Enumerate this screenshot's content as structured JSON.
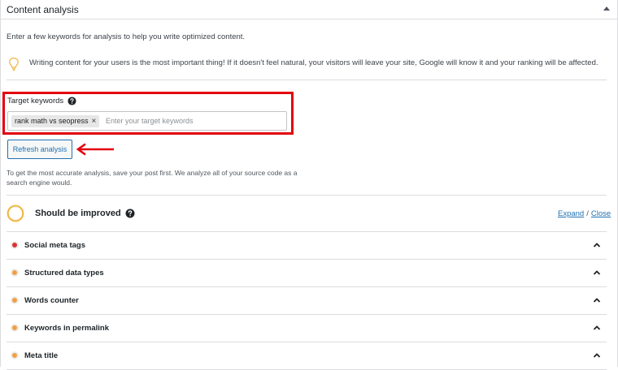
{
  "panel": {
    "title": "Content analysis",
    "intro": "Enter a few keywords for analysis to help you write optimized content.",
    "tip": "Writing content for your users is the most important thing! If it doesn't feel natural, your visitors will leave your site, Google will know it and your ranking will be affected."
  },
  "keywords": {
    "label": "Target keywords",
    "tag": "rank math vs seopress",
    "tag_remove": "×",
    "placeholder": "Enter your target keywords"
  },
  "refresh_label": "Refresh analysis",
  "help_text": "To get the most accurate analysis, save your post first. We analyze all of your source code as a search engine would.",
  "score": {
    "title": "Should be improved",
    "expand_label": "Expand",
    "separator": "/",
    "close_label": "Close",
    "ring_color": "#f0b849"
  },
  "checks": [
    {
      "label": "Social meta tags",
      "status": "error",
      "color": "#dc3232"
    },
    {
      "label": "Structured data types",
      "status": "warning",
      "color": "#f0a042"
    },
    {
      "label": "Words counter",
      "status": "warning",
      "color": "#f0a042"
    },
    {
      "label": "Keywords in permalink",
      "status": "warning",
      "color": "#f0a042"
    },
    {
      "label": "Meta title",
      "status": "warning",
      "color": "#f0a042"
    }
  ],
  "colors": {
    "accent": "#2271b1",
    "annotation": "#e3000f",
    "divider": "#dcdcde"
  },
  "icons": {
    "collapse": "caret-up-icon",
    "tip": "lightbulb-icon",
    "help": "question-circle-icon",
    "row_toggle": "chevron-up-icon",
    "annotation": "red-arrow-icon"
  }
}
